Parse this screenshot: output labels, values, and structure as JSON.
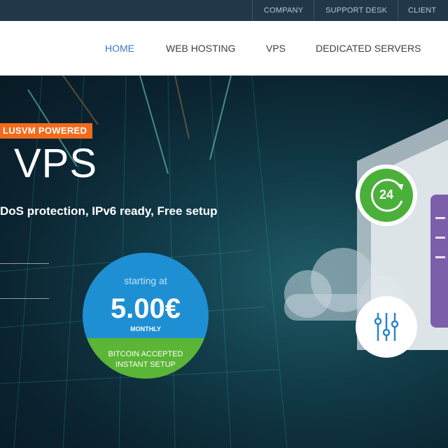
{
  "topbar": {
    "links": [
      "COMPANY",
      "SUPPORT DESK",
      "CLIENT AR"
    ]
  },
  "nav": {
    "items": [
      {
        "label": "HOME",
        "active": true
      },
      {
        "label": "WEB HOSTING",
        "active": false
      },
      {
        "label": "VPS",
        "active": false
      },
      {
        "label": "DEDICATED SERVERS",
        "active": false
      }
    ]
  },
  "hero": {
    "badge": "LUSVM POWERED",
    "title": "VPS",
    "features": "DoS protection, IPv6 ready, Free setup",
    "price": {
      "starting_label": "starting at",
      "value": "5.00€",
      "period": "MONTHLY",
      "bitcoin": "BITCOIN ACCEPTED",
      "setup": "INSTANT SETUP"
    },
    "support_badge": "24"
  },
  "icons": [
    "24-hour-support-icon",
    "sliders-icon",
    "cloud-icon",
    "server-rack-icon"
  ],
  "colors": {
    "topbar_bg": "#21384a",
    "nav_active": "#3c78c8",
    "badge_orange": "#f26b1d",
    "price_blue": "#1f8fd3",
    "price_green": "#5bb536",
    "support_green": "#4bb03a",
    "server_purple": "#7d5ea8"
  }
}
